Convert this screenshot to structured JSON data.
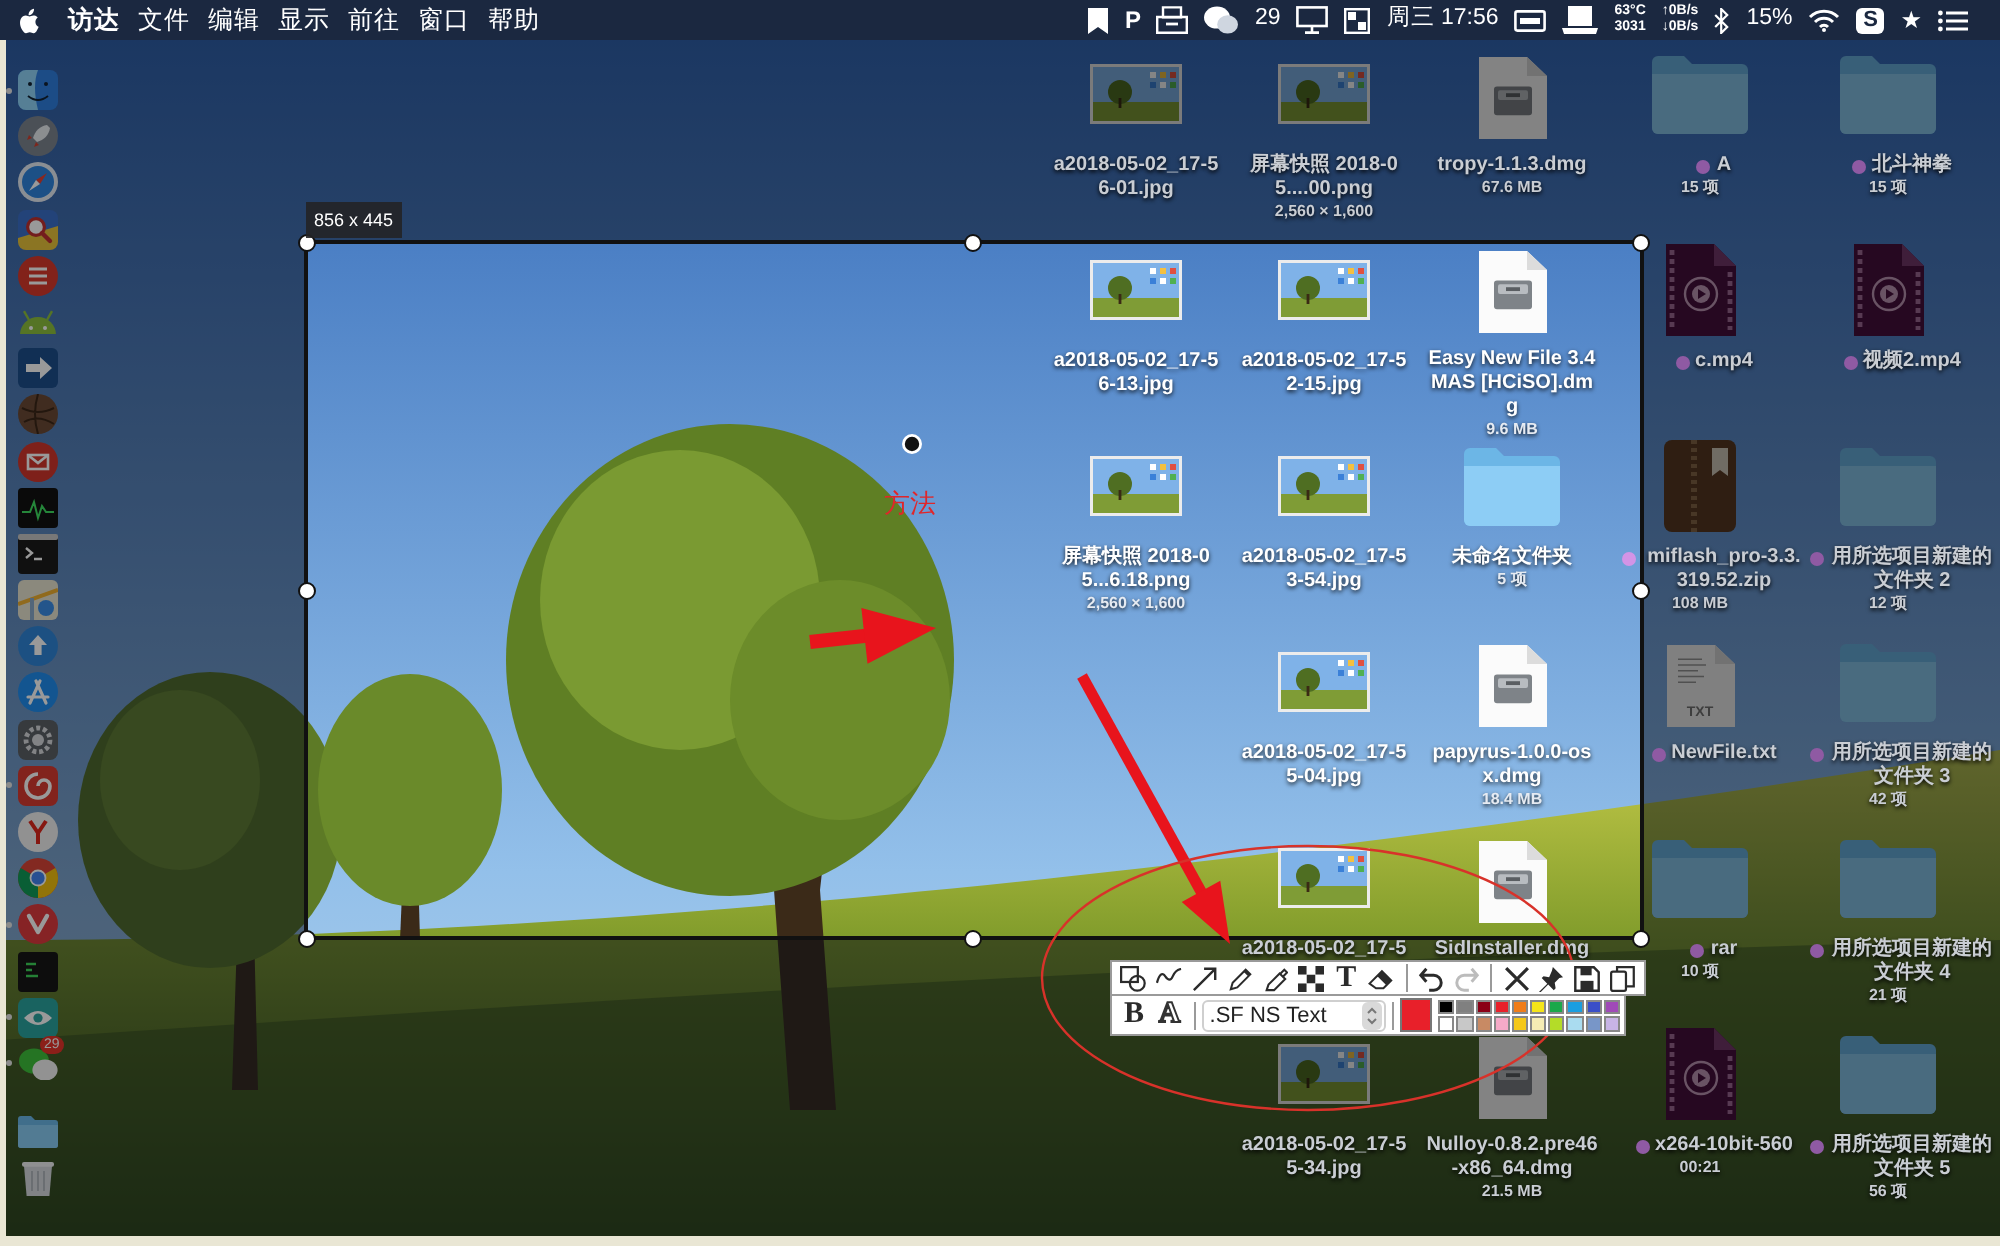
{
  "menu_bar": {
    "menus": [
      "访达",
      "文件",
      "编辑",
      "显示",
      "前往",
      "窗口",
      "帮助"
    ],
    "status_items": [
      {
        "kind": "bookmark"
      },
      {
        "kind": "glyph",
        "text": "P"
      },
      {
        "kind": "tray"
      },
      {
        "kind": "chat"
      },
      {
        "kind": "text",
        "text": "29"
      },
      {
        "kind": "monitor"
      },
      {
        "kind": "layout"
      },
      {
        "kind": "text",
        "text": "周三 17:56"
      },
      {
        "kind": "card"
      },
      {
        "kind": "laptop"
      },
      {
        "kind": "stack",
        "lines": [
          "63°C",
          "3031"
        ]
      },
      {
        "kind": "stack",
        "lines": [
          "↑0B/s",
          "↓0B/s"
        ]
      },
      {
        "kind": "bluetooth"
      },
      {
        "kind": "text",
        "text": "15%"
      },
      {
        "kind": "wifi"
      },
      {
        "kind": "tile",
        "text": "S"
      },
      {
        "kind": "glyph",
        "text": "★"
      },
      {
        "kind": "list"
      }
    ]
  },
  "dock": {
    "apps": [
      {
        "kind": "smiley",
        "running": true
      },
      {
        "kind": "rocket",
        "running": false
      },
      {
        "kind": "compass",
        "running": false
      },
      {
        "kind": "magnifier",
        "running": false
      },
      {
        "kind": "lines",
        "running": false
      },
      {
        "kind": "robot",
        "running": false
      },
      {
        "kind": "arrowtile",
        "running": false
      },
      {
        "kind": "ball",
        "running": false
      },
      {
        "kind": "envelope",
        "running": false
      },
      {
        "kind": "graph",
        "running": false
      },
      {
        "kind": "terminal",
        "running": false
      },
      {
        "kind": "map",
        "running": false
      },
      {
        "kind": "upload",
        "running": false
      },
      {
        "kind": "tools",
        "running": false
      },
      {
        "kind": "gear",
        "running": false
      },
      {
        "kind": "swirl",
        "running": true
      },
      {
        "kind": "fork",
        "running": false
      },
      {
        "kind": "tricolor",
        "running": false
      },
      {
        "kind": "chevron",
        "running": true
      },
      {
        "kind": "console",
        "running": false
      },
      {
        "kind": "eye",
        "running": true
      },
      {
        "kind": "chat",
        "running": true,
        "badge": "29"
      }
    ],
    "stacks": [
      {
        "kind": "folder"
      },
      {
        "kind": "trash"
      }
    ]
  },
  "desktop": {
    "columns": [
      {
        "items": [
          {
            "kind": "image",
            "name": "a2018-05-02_17-56-01.jpg"
          },
          {
            "kind": "image",
            "name": "a2018-05-02_17-56-13.jpg"
          },
          {
            "kind": "image",
            "name": "屏幕快照 2018-05...6.18.png",
            "info": "2,560 × 1,600"
          }
        ]
      },
      {
        "items": [
          {
            "kind": "image",
            "name": "屏幕快照 2018-05....00.png",
            "info": "2,560 × 1,600"
          },
          {
            "kind": "image",
            "name": "a2018-05-02_17-52-15.jpg"
          },
          {
            "kind": "image",
            "name": "a2018-05-02_17-53-54.jpg"
          },
          {
            "kind": "image",
            "name": "a2018-05-02_17-55-04.jpg"
          },
          {
            "kind": "image",
            "name": "a2018-05-02_17-5"
          },
          {
            "kind": "image",
            "name": "a2018-05-02_17-55-34.jpg"
          }
        ]
      },
      {
        "items": [
          {
            "kind": "disk",
            "name": "tropy-1.1.3.dmg",
            "info": "67.6 MB"
          },
          {
            "kind": "disk",
            "name": "Easy New File 3.4 MAS [HCiSO].dmg",
            "info": "9.6 MB"
          },
          {
            "kind": "folder",
            "name": "未命名文件夹",
            "info": "5 项"
          },
          {
            "kind": "disk",
            "name": "papyrus-1.0.0-osx.dmg",
            "info": "18.4 MB"
          },
          {
            "kind": "disk",
            "name": "SidInstaller.dmg"
          },
          {
            "kind": "disk",
            "name": "Nulloy-0.8.2.pre46-x86_64.dmg",
            "info": "21.5 MB"
          }
        ]
      },
      {
        "items": [
          {
            "kind": "folder",
            "name": "A",
            "info": "15 项",
            "color": "#8f5aa3"
          },
          {
            "kind": "video",
            "name": "c.mp4",
            "color": "#8f5aa3"
          },
          {
            "kind": "zip",
            "name": "miflash_pro-3.3.319.52.zip",
            "info": "108 MB",
            "color": "#d394e6"
          },
          {
            "kind": "textfile",
            "name": "NewFile.txt",
            "icon_text": "TXT",
            "color": "#8f5aa3"
          },
          {
            "kind": "folder",
            "name": "rar",
            "info": "10 项",
            "color": "#8f5aa3"
          },
          {
            "kind": "video",
            "name": "x264-10bit-560",
            "info": "00:21",
            "color": "#8f5aa3"
          }
        ]
      },
      {
        "items": [
          {
            "kind": "folder",
            "name": "北斗神拳",
            "info": "15 项",
            "color": "#8f5aa3"
          },
          {
            "kind": "video",
            "name": "视频2.mp4",
            "color": "#8f5aa3"
          },
          {
            "kind": "folder",
            "name": "用所选项目新建的文件夹 2",
            "info": "12 项",
            "color": "#8f5aa3"
          },
          {
            "kind": "folder",
            "name": "用所选项目新建的文件夹 3",
            "info": "42 项",
            "color": "#8f5aa3"
          },
          {
            "kind": "folder",
            "name": "用所选项目新建的文件夹 4",
            "info": "21 项",
            "color": "#8f5aa3"
          },
          {
            "kind": "folder",
            "name": "用所选项目新建的文件夹 5",
            "info": "56 项",
            "color": "#8f5aa3"
          }
        ]
      }
    ]
  },
  "selection": {
    "size_label": "856 x 445"
  },
  "annotations": [
    {
      "kind": "text",
      "text": "方法"
    },
    {
      "kind": "arrow"
    },
    {
      "kind": "arrow"
    },
    {
      "kind": "ellipse"
    }
  ],
  "toolbar": {
    "tool_groups": [
      {
        "tools": [
          {
            "kind": "shape",
            "disabled": false
          },
          {
            "kind": "freehand",
            "disabled": false
          },
          {
            "kind": "arrow",
            "disabled": false
          },
          {
            "kind": "pencil",
            "disabled": false
          },
          {
            "kind": "marker",
            "disabled": false
          },
          {
            "kind": "mosaic",
            "disabled": false
          },
          {
            "kind": "text",
            "label": "T",
            "disabled": false
          },
          {
            "kind": "eraser",
            "disabled": false
          }
        ]
      },
      {
        "tools": [
          {
            "kind": "undo",
            "disabled": false
          },
          {
            "kind": "redo",
            "disabled": true
          }
        ]
      },
      {
        "tools": [
          {
            "kind": "close",
            "disabled": false
          },
          {
            "kind": "pin",
            "disabled": false
          },
          {
            "kind": "save",
            "disabled": false
          },
          {
            "kind": "copy",
            "disabled": false
          }
        ]
      }
    ],
    "text_options": {
      "bold_label": "B",
      "outline_label": "A",
      "font": ".SF NS Text",
      "current": {
        "color": "#e8202a"
      },
      "palette": [
        {
          "color": "#000000"
        },
        {
          "color": "#808080"
        },
        {
          "color": "#8b0016"
        },
        {
          "color": "#e8202a"
        },
        {
          "color": "#f07d1a"
        },
        {
          "color": "#f5e51a"
        },
        {
          "color": "#1aa84a"
        },
        {
          "color": "#1a9ee0"
        },
        {
          "color": "#3a4fc8"
        },
        {
          "color": "#a04ab8"
        },
        {
          "color": "#ffffff"
        },
        {
          "color": "#c8c8c8"
        },
        {
          "color": "#c88a64"
        },
        {
          "color": "#f5aac8"
        },
        {
          "color": "#f5c81a"
        },
        {
          "color": "#f5ecb4"
        },
        {
          "color": "#b4dc28"
        },
        {
          "color": "#aadcf0"
        },
        {
          "color": "#7896c8"
        },
        {
          "color": "#c8b4e6"
        }
      ]
    }
  }
}
